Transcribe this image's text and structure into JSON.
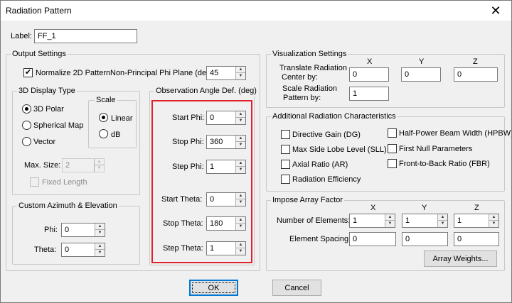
{
  "window": {
    "title": "Radiation Pattern",
    "close_icon": "close-icon"
  },
  "label": {
    "caption": "Label:",
    "value": "FF_1"
  },
  "output_settings": {
    "title": "Output Settings",
    "normalize_label": "Normalize 2D Pattern",
    "normalize_checked": true,
    "non_principal_label": "Non-Principal Phi Plane (deg):",
    "non_principal_value": "45"
  },
  "display_type": {
    "title": "3D Display Type",
    "options": [
      "3D Polar",
      "Spherical Map",
      "Vector"
    ],
    "selected": "3D Polar",
    "scale_title": "Scale",
    "scale_options": [
      "Linear",
      "dB"
    ],
    "scale_selected": "Linear",
    "max_size_label": "Max. Size:",
    "max_size_value": "2",
    "fixed_length_label": "Fixed Length"
  },
  "observation": {
    "title": "Observation Angle Def. (deg)",
    "start_phi_label": "Start Phi:",
    "start_phi": "0",
    "stop_phi_label": "Stop Phi:",
    "stop_phi": "360",
    "step_phi_label": "Step Phi:",
    "step_phi": "1",
    "start_theta_label": "Start Theta:",
    "start_theta": "0",
    "stop_theta_label": "Stop Theta:",
    "stop_theta": "180",
    "step_theta_label": "Step Theta:",
    "step_theta": "1",
    "highlight_color": "#e0202a"
  },
  "custom_az_el": {
    "title": "Custom Azimuth & Elevation",
    "phi_label": "Phi:",
    "phi": "0",
    "theta_label": "Theta:",
    "theta": "0"
  },
  "visualization": {
    "title": "Visualization Settings",
    "x_header": "X",
    "y_header": "Y",
    "z_header": "Z",
    "translate_label_1": "Translate Radiation",
    "translate_label_2": "Center by:",
    "translate_x": "0",
    "translate_y": "0",
    "translate_z": "0",
    "scale_label_1": "Scale Radiation",
    "scale_label_2": "Pattern by:",
    "scale_value": "1"
  },
  "additional": {
    "title": "Additional Radiation Characteristics",
    "left_options": [
      "Directive Gain (DG)",
      "Max Side Lobe Level (SLL)",
      "Axial Ratio (AR)",
      "Radiation Efficiency"
    ],
    "right_options": [
      "Half-Power Beam Width (HPBW)",
      "First Null Parameters",
      "Front-to-Back Ratio (FBR)"
    ]
  },
  "array_factor": {
    "title": "Impose Array Factor",
    "x_header": "X",
    "y_header": "Y",
    "z_header": "Z",
    "num_elements_label": "Number of Elements:",
    "num_x": "1",
    "num_y": "1",
    "num_z": "1",
    "spacing_label": "Element Spacing:",
    "spacing_x": "0",
    "spacing_y": "0",
    "spacing_z": "0",
    "weights_button": "Array Weights..."
  },
  "buttons": {
    "ok": "OK",
    "cancel": "Cancel"
  }
}
